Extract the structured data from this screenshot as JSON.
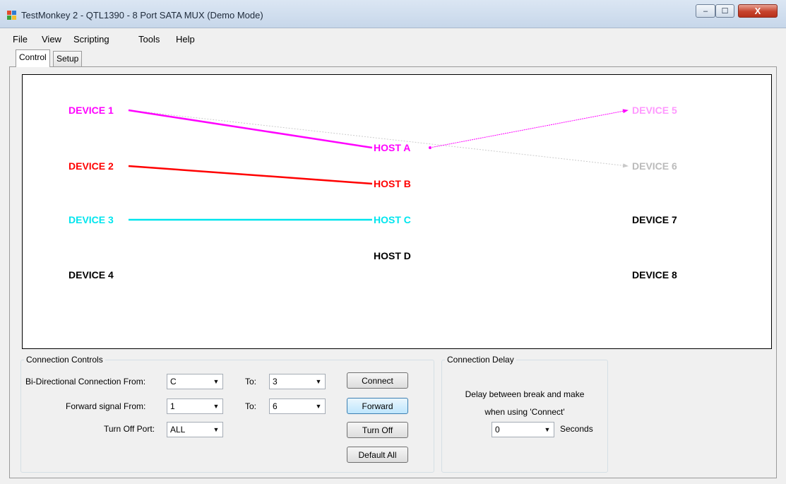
{
  "window": {
    "title": "TestMonkey 2 - QTL1390 - 8 Port SATA MUX (Demo Mode)",
    "icon": "app-icon",
    "controls": {
      "minimize": "–",
      "maximize": "☐",
      "close": "X"
    }
  },
  "menu": [
    "File",
    "View",
    "Scripting",
    "Tools",
    "Help"
  ],
  "tabs": [
    {
      "label": "Control",
      "active": true
    },
    {
      "label": "Setup",
      "active": false
    }
  ],
  "diagram": {
    "devices_left": [
      {
        "label": "DEVICE 1",
        "color": "#ff00ff"
      },
      {
        "label": "DEVICE 2",
        "color": "#ff0000"
      },
      {
        "label": "DEVICE 3",
        "color": "#00e5ee"
      },
      {
        "label": "DEVICE 4",
        "color": "#000000"
      }
    ],
    "hosts": [
      {
        "label": "HOST A",
        "color": "#ff00ff"
      },
      {
        "label": "HOST B",
        "color": "#ff0000"
      },
      {
        "label": "HOST C",
        "color": "#00e5ee"
      },
      {
        "label": "HOST D",
        "color": "#000000"
      }
    ],
    "devices_right": [
      {
        "label": "DEVICE 5",
        "color": "#ff99ff"
      },
      {
        "label": "DEVICE 6",
        "color": "#bbbbbb"
      },
      {
        "label": "DEVICE 7",
        "color": "#000000"
      },
      {
        "label": "DEVICE 8",
        "color": "#000000"
      }
    ],
    "connections": [
      {
        "from": "DEVICE 1",
        "to": "HOST A",
        "type": "bi-directional",
        "color": "#ff00ff"
      },
      {
        "from": "DEVICE 2",
        "to": "HOST B",
        "type": "bi-directional",
        "color": "#ff0000"
      },
      {
        "from": "DEVICE 3",
        "to": "HOST C",
        "type": "bi-directional",
        "color": "#00e5ee"
      },
      {
        "from": "HOST A",
        "to": "DEVICE 5",
        "type": "forward",
        "color": "#ff00ff"
      },
      {
        "from": "DEVICE 1",
        "to": "DEVICE 6",
        "type": "forward",
        "color": "#cccccc"
      }
    ]
  },
  "connection_controls": {
    "title": "Connection Controls",
    "bi_label": "Bi-Directional Connection  From:",
    "bi_from": "C",
    "to_label": "To:",
    "bi_to": "3",
    "fwd_label": "Forward signal  From:",
    "fwd_from": "1",
    "fwd_to": "6",
    "off_label": "Turn Off Port:",
    "off_port": "ALL",
    "buttons": {
      "connect": "Connect",
      "forward": "Forward",
      "turn_off": "Turn Off",
      "default_all": "Default All"
    }
  },
  "connection_delay": {
    "title": "Connection Delay",
    "desc_line1": "Delay between break and make",
    "desc_line2": "when using 'Connect'",
    "value": "0",
    "unit": "Seconds"
  }
}
